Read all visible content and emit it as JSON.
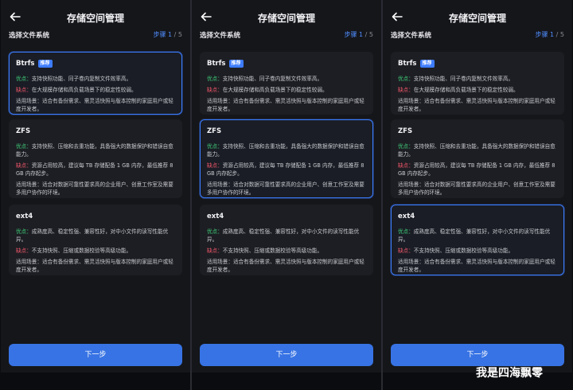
{
  "header": {
    "title": "存储空间管理"
  },
  "subhead": {
    "subtitle": "选择文件系统",
    "step_label": "步骤",
    "step_current": "1",
    "step_total": "/ 5"
  },
  "cards": [
    {
      "name": "Btrfs",
      "badge": "推荐",
      "pro_label": "优点：",
      "pro": "支持快照功能、同子卷内复制文件效率高。",
      "con_label": "缺点：",
      "con": "在大规模存储和高负载场景下的稳定性较弱。",
      "use_label": "适用场景：",
      "use": "适合有备份需求、需灵活快照与版本控制的家庭用户或轻度开发者。"
    },
    {
      "name": "ZFS",
      "pro_label": "优点：",
      "pro": "支持快照、压缩和去重功能，具备强大的数据保护和错误自愈能力。",
      "con_label": "缺点：",
      "con": "资源占用较高，建议每 TB 存储配备 1 GB 内存，最低推荐 8 GB 内存起步。",
      "use_label": "适用场景：",
      "use": "适合对数据可靠性要求高的企业用户、创意工作室及需要多用户协作的环境。"
    },
    {
      "name": "ext4",
      "pro_label": "优点：",
      "pro": "成熟度高、稳定性强、兼容性好，对中小文件的读写性能优异。",
      "con_label": "缺点：",
      "con": "不支持快照、压缩或数据校验等高级功能。",
      "use_label": "适用场景：",
      "use": "适合有备份需求、需灵活快照与版本控制的家庭用户或轻度开发者。"
    }
  ],
  "next_button": "下一步",
  "watermark": "我是四海飘零"
}
